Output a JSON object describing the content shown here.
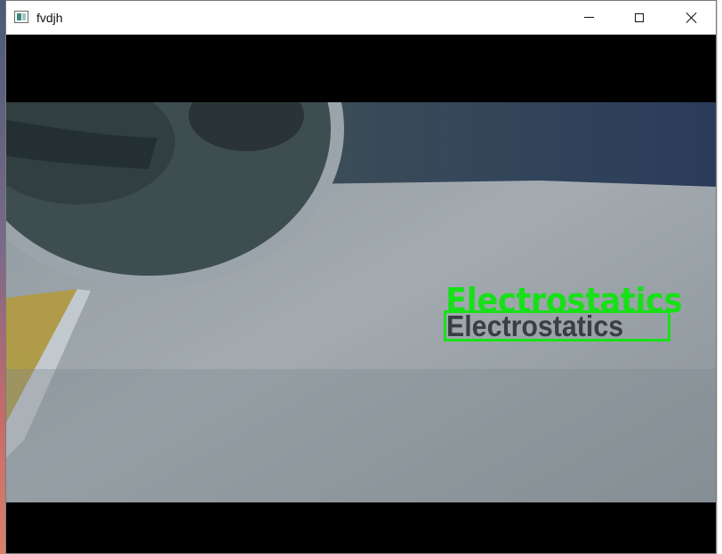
{
  "window": {
    "title": "fvdjh",
    "icon": "app-window-icon",
    "controls": {
      "minimize_icon": "minimize-icon",
      "maximize_icon": "maximize-icon",
      "close_icon": "close-icon"
    }
  },
  "camera_feed": {
    "detection": {
      "label": "Electrostatics",
      "box_color": "#18e018"
    },
    "scene_text": "Electrostatics"
  }
}
